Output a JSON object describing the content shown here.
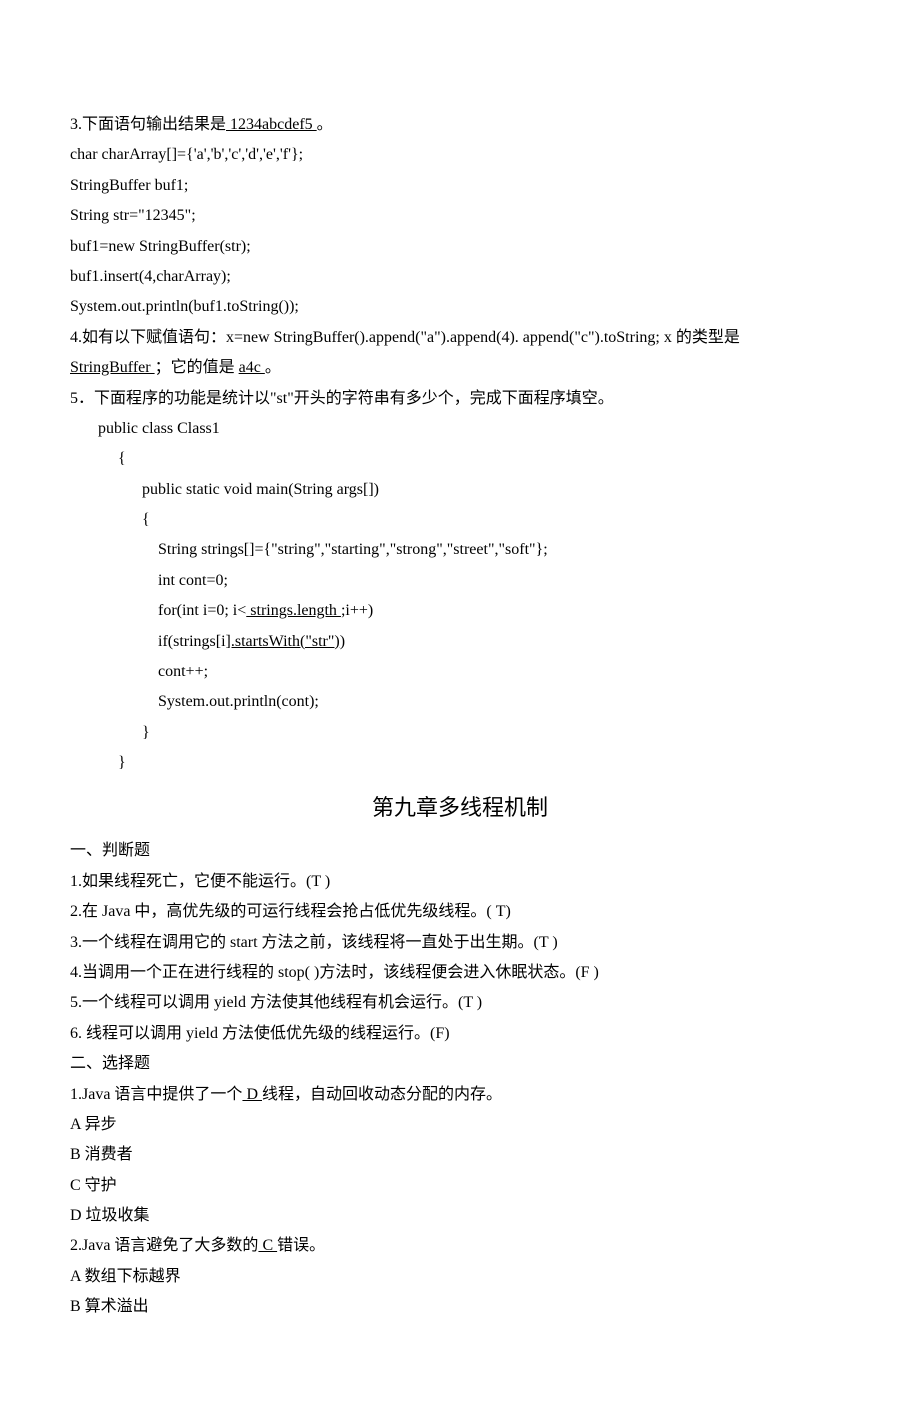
{
  "q3": {
    "prefix": "3.下面语句输出结果是",
    "answer": "   1234abcdef5                                ",
    "suffix": "。",
    "code": [
      "char charArray[]={'a','b','c','d','e','f'};",
      "StringBuffer buf1;",
      "String str=\"12345\";",
      "buf1=new StringBuffer(str);",
      "buf1.insert(4,charArray);",
      "System.out.println(buf1.toString());"
    ]
  },
  "q4": {
    "part1": "4.如有以下赋值语句：x=new StringBuffer().append(\"a\").append(4). append(\"c\").toString;    x 的类型是",
    "ans1": "StringBuffer           ",
    "part2": " ；它的值是   ",
    "ans2": "   a4c      ",
    "part3": " 。"
  },
  "q5": {
    "text": "5．下面程序的功能是统计以\"st\"开头的字符串有多少个，完成下面程序填空。",
    "code_a": "public class Class1",
    "code_b": "{",
    "code_c": "public static void main(String args[])",
    "code_d": "{",
    "code_e": "String strings[]={\"string\",\"starting\",\"strong\",\"street\",\"soft\"};",
    "code_f": "int cont=0;",
    "code_g_pre": "for(int i=0; i<",
    "code_g_ans": " strings.length ",
    "code_g_post": ";i++)",
    "code_h_pre": " if(strings[i",
    "code_h_ans": "].startsWith(\"str\")",
    "code_h_post": ")",
    "code_i": " cont++;",
    "code_j": " System.out.println(cont);",
    "code_k": "}",
    "code_l": "}"
  },
  "chapter": "第九章多线程机制",
  "sec1_title": "一、判断题",
  "sec1": {
    "i1": "1.如果线程死亡，它便不能运行。(T  )",
    "i2": "2.在  Java  中，高优先级的可运行线程会抢占低优先级线程。(  T)",
    "i3": "3.一个线程在调用它的  start  方法之前，该线程将一直处于出生期。(T  )",
    "i4": "4.当调用一个正在进行线程的  stop( )方法时，该线程便会进入休眠状态。(F  )",
    "i5": "5.一个线程可以调用  yield  方法使其他线程有机会运行。(T  )",
    "i6": "6.  线程可以调用 yield 方法使低优先级的线程运行。(F)"
  },
  "sec2_title": "二、选择题",
  "sec2_q1": {
    "pre": "1.Java  语言中提供了一个",
    "ans": "  D  ",
    "post": "线程，自动回收动态分配的内存。",
    "a": "A  异步",
    "b": "B  消费者",
    "c": "C  守护",
    "d": "D  垃圾收集"
  },
  "sec2_q2": {
    "pre": "2.Java 语言避免了大多数的",
    "ans": "      C      ",
    "post": "错误。",
    "a": "A  数组下标越界",
    "b": "B  算术溢出"
  }
}
